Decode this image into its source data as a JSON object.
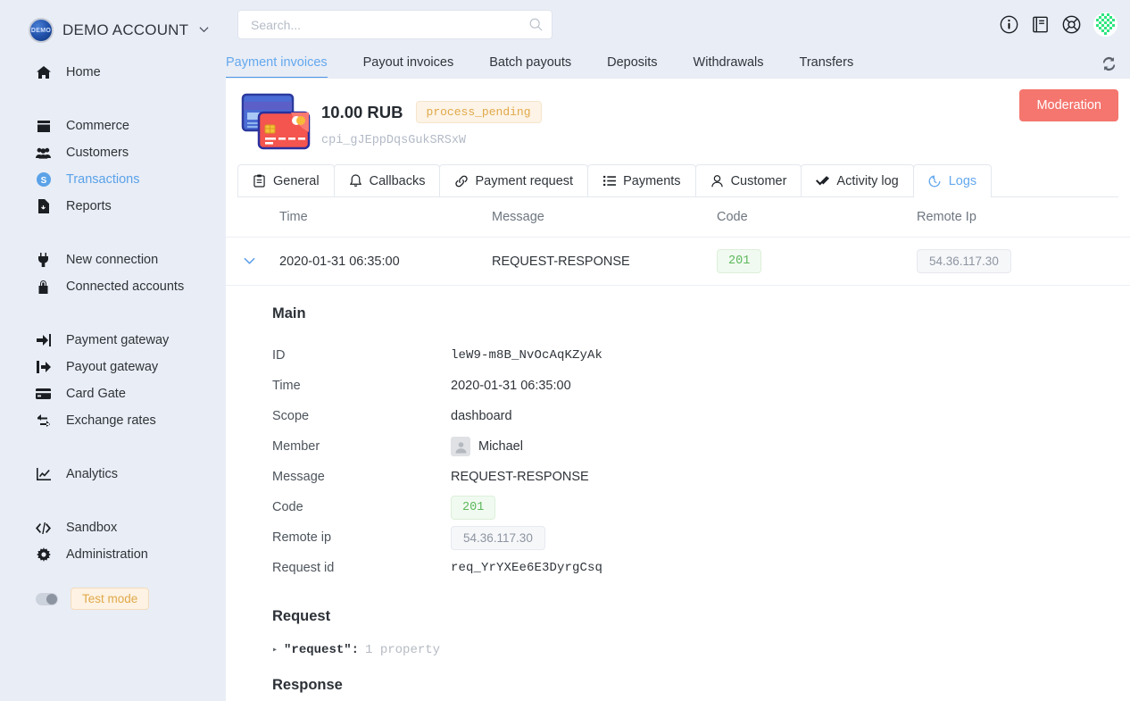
{
  "sidebar": {
    "brand": {
      "logo_text": "DEMO",
      "name": "DEMO ACCOUNT",
      "caret": "⌄"
    },
    "groups": [
      {
        "items": [
          {
            "label": "Home",
            "icon": "home-icon",
            "active": false
          }
        ]
      },
      {
        "items": [
          {
            "label": "Commerce",
            "icon": "store-icon",
            "active": false
          },
          {
            "label": "Customers",
            "icon": "users-icon",
            "active": false
          },
          {
            "label": "Transactions",
            "icon": "dollar-circle-icon",
            "active": true
          },
          {
            "label": "Reports",
            "icon": "report-file-icon",
            "active": false
          }
        ]
      },
      {
        "items": [
          {
            "label": "New connection",
            "icon": "plug-icon",
            "active": false
          },
          {
            "label": "Connected accounts",
            "icon": "lock-icon",
            "active": false
          }
        ]
      },
      {
        "items": [
          {
            "label": "Payment gateway",
            "icon": "sign-in-icon",
            "active": false
          },
          {
            "label": "Payout gateway",
            "icon": "sign-out-icon",
            "active": false
          },
          {
            "label": "Card Gate",
            "icon": "credit-card-icon",
            "active": false
          },
          {
            "label": "Exchange rates",
            "icon": "exchange-icon",
            "active": false
          }
        ]
      },
      {
        "items": [
          {
            "label": "Analytics",
            "icon": "chart-line-icon",
            "active": false
          }
        ]
      },
      {
        "items": [
          {
            "label": "Sandbox",
            "icon": "code-icon",
            "active": false
          },
          {
            "label": "Administration",
            "icon": "gear-icon",
            "active": false
          }
        ]
      }
    ],
    "test_mode": {
      "label": "Test mode",
      "enabled": false
    }
  },
  "topbar": {
    "search": {
      "value": "",
      "placeholder": "Search..."
    },
    "icons": [
      "info-circle-icon",
      "book-icon",
      "life-ring-icon"
    ],
    "avatar": "user-identicon-avatar"
  },
  "top_tabs": [
    {
      "label": "Payment invoices",
      "active": true
    },
    {
      "label": "Payout invoices",
      "active": false
    },
    {
      "label": "Batch payouts",
      "active": false
    },
    {
      "label": "Deposits",
      "active": false
    },
    {
      "label": "Withdrawals",
      "active": false
    },
    {
      "label": "Transfers",
      "active": false
    }
  ],
  "refresh_icon": "refresh-icon",
  "invoice": {
    "icon": "two-credit-cards-icon",
    "amount": "10.00 RUB",
    "status": "process_pending",
    "id": "cpi_gJEppDqsGukSRSxW",
    "moderation_label": "Moderation",
    "moderation_color": "#f4766e"
  },
  "inner_tabs": [
    {
      "label": "General",
      "icon": "clipboard-icon",
      "active": false
    },
    {
      "label": "Callbacks",
      "icon": "bell-icon",
      "active": false
    },
    {
      "label": "Payment request",
      "icon": "link-icon",
      "active": false
    },
    {
      "label": "Payments",
      "icon": "list-icon",
      "active": false
    },
    {
      "label": "Customer",
      "icon": "user-icon",
      "active": false
    },
    {
      "label": "Activity log",
      "icon": "double-check-icon",
      "active": false
    },
    {
      "label": "Logs",
      "icon": "history-icon",
      "active": true
    }
  ],
  "log_table": {
    "columns": [
      "Time",
      "Message",
      "Code",
      "Remote Ip"
    ],
    "rows": [
      {
        "expanded": true,
        "time": "2020-01-31 06:35:00",
        "message": "REQUEST-RESPONSE",
        "code": "201",
        "remote_ip": "54.36.117.30"
      }
    ]
  },
  "detail": {
    "main_title": "Main",
    "fields": [
      {
        "label": "ID",
        "value": "leW9-m8B_NvOcAqKZyAk",
        "type": "mono"
      },
      {
        "label": "Time",
        "value": "2020-01-31 06:35:00",
        "type": "text"
      },
      {
        "label": "Scope",
        "value": "dashboard",
        "type": "text"
      },
      {
        "label": "Member",
        "value": "Michael",
        "type": "member"
      },
      {
        "label": "Message",
        "value": "REQUEST-RESPONSE",
        "type": "text"
      },
      {
        "label": "Code",
        "value": "201",
        "type": "code-badge"
      },
      {
        "label": "Remote ip",
        "value": "54.36.117.30",
        "type": "ip-badge"
      },
      {
        "label": "Request id",
        "value": "req_YrYXEe6E3DyrgCsq",
        "type": "mono"
      }
    ],
    "request_title": "Request",
    "request_key": "\"request\":",
    "request_meta": "1 property",
    "response_title": "Response"
  }
}
